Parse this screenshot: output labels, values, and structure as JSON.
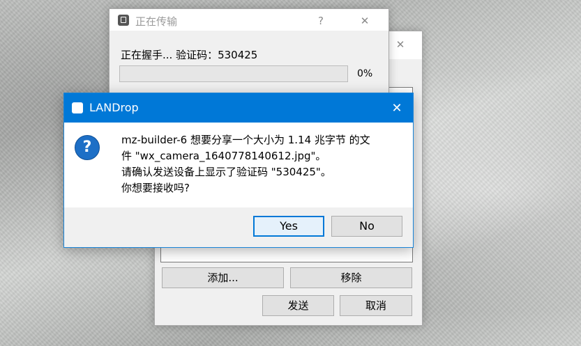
{
  "background_window": {
    "close_glyph": "✕",
    "buttons": {
      "add": "添加...",
      "remove": "移除",
      "send": "发送",
      "cancel": "取消"
    }
  },
  "transfer_window": {
    "title": "正在传输",
    "help_glyph": "?",
    "close_glyph": "✕",
    "status_text": "正在握手... 验证码：530425",
    "progress_percent_label": "0%",
    "progress_value": 0
  },
  "dialog": {
    "title": "LANDrop",
    "close_glyph": "✕",
    "icon": "question-icon",
    "icon_glyph": "?",
    "message_lines": [
      "mz-builder-6 想要分享一个大小为 1.14 兆字节 的文",
      "件 \"wx_camera_1640778140612.jpg\"。",
      "请确认发送设备上显示了验证码 \"530425\"。",
      "你想要接收吗?"
    ],
    "yes_label": "Yes",
    "no_label": "No"
  },
  "colors": {
    "accent": "#0078d7",
    "progress": "#06b025"
  }
}
